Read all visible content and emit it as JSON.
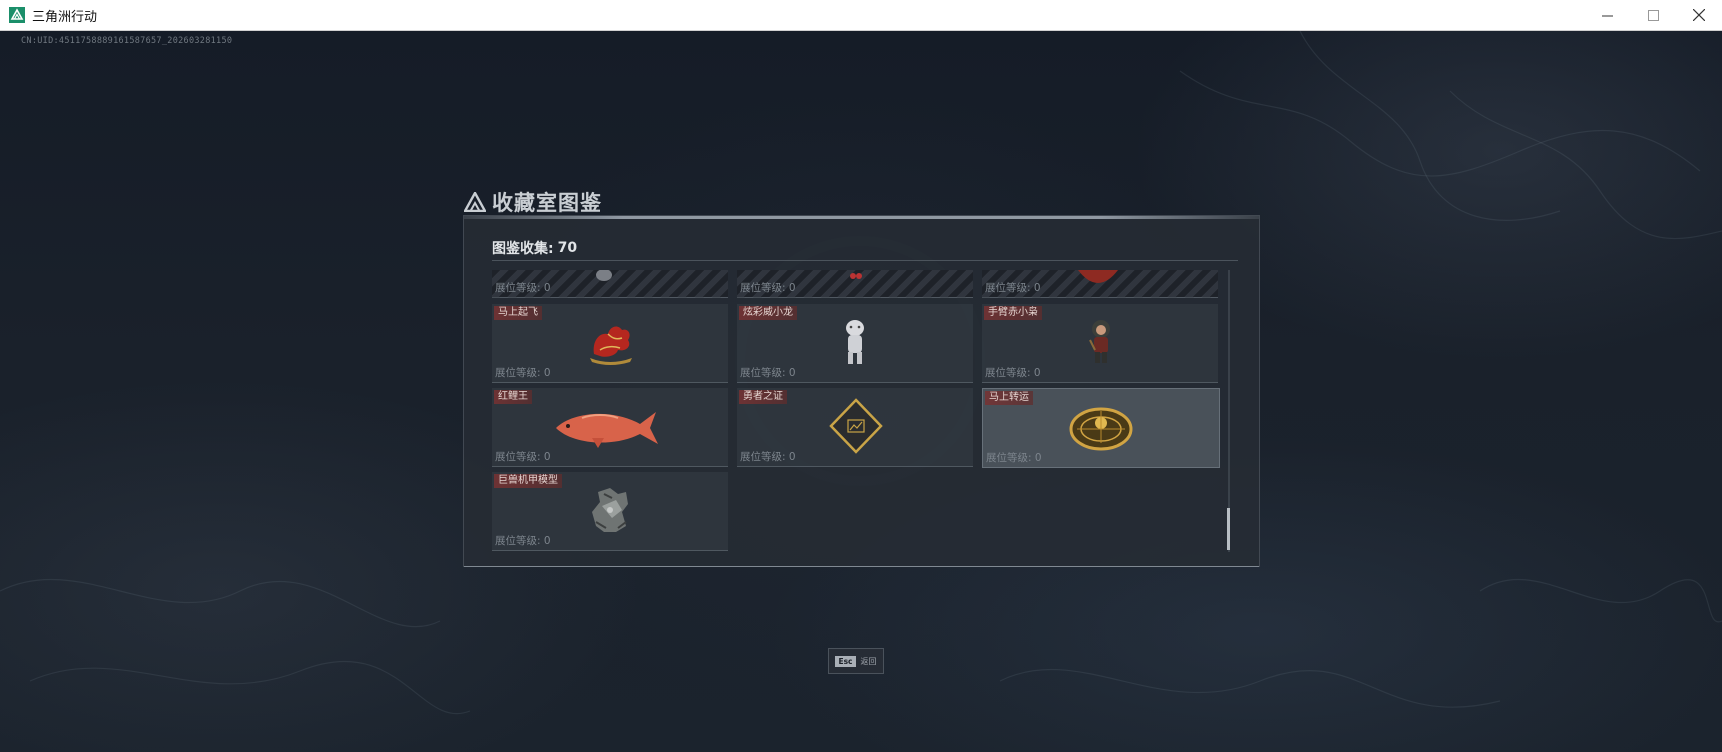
{
  "window": {
    "title": "三角洲行动",
    "controls": [
      "minimize-icon",
      "maximize-icon",
      "close-icon"
    ]
  },
  "uid_text": "CN:UID:4511758889161587657_202603281150",
  "panel": {
    "title": "收藏室图鉴",
    "collection_label": "图鉴收集:",
    "collection_count": "70",
    "level_label": "展位等级:",
    "items": [
      {
        "name": "",
        "level": "0",
        "partial": true
      },
      {
        "name": "",
        "level": "0",
        "partial": true
      },
      {
        "name": "",
        "level": "0",
        "partial": true
      },
      {
        "name": "马上起飞",
        "level": "0",
        "icon": "horse-statue-icon"
      },
      {
        "name": "炫彩威小龙",
        "level": "0",
        "icon": "dragon-figure-icon"
      },
      {
        "name": "手臂赤小枭",
        "level": "0",
        "icon": "owl-figure-icon"
      },
      {
        "name": "红鲤王",
        "level": "0",
        "icon": "carp-icon"
      },
      {
        "name": "勇者之证",
        "level": "0",
        "icon": "badge-card-icon"
      },
      {
        "name": "马上转运",
        "level": "0",
        "icon": "compass-icon",
        "selected": true
      },
      {
        "name": "巨兽机甲模型",
        "level": "0",
        "icon": "mecha-model-icon"
      }
    ]
  },
  "esc_hint": {
    "key": "Esc",
    "label": "返回"
  },
  "colors": {
    "name_tag": "#7a3232",
    "background": "#151c27",
    "panel": "#262c34"
  }
}
